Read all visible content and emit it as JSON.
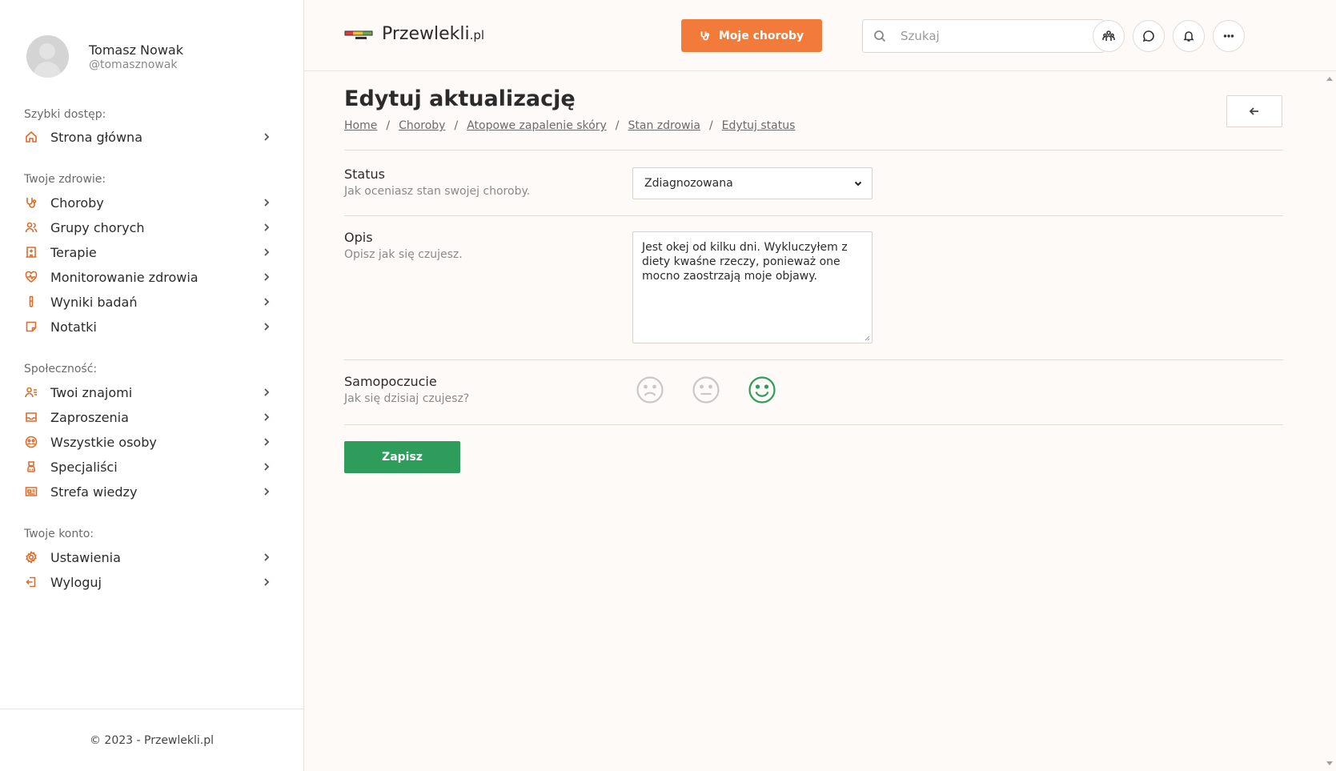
{
  "user": {
    "name": "Tomasz Nowak",
    "handle": "@tomasznowak"
  },
  "sidebar": {
    "sections": [
      {
        "title": "Szybki dostęp:",
        "items": [
          {
            "label": "Strona główna",
            "icon": "home-icon"
          }
        ]
      },
      {
        "title": "Twoje zdrowie:",
        "items": [
          {
            "label": "Choroby",
            "icon": "stethoscope-icon"
          },
          {
            "label": "Grupy chorych",
            "icon": "users-icon"
          },
          {
            "label": "Terapie",
            "icon": "hospital-icon"
          },
          {
            "label": "Monitorowanie zdrowia",
            "icon": "heart-pulse-icon"
          },
          {
            "label": "Wyniki badań",
            "icon": "test-tube-icon"
          },
          {
            "label": "Notatki",
            "icon": "note-icon"
          }
        ]
      },
      {
        "title": "Społeczność:",
        "items": [
          {
            "label": "Twoi znajomi",
            "icon": "user-list-icon"
          },
          {
            "label": "Zaproszenia",
            "icon": "inbox-icon"
          },
          {
            "label": "Wszystkie osoby",
            "icon": "globe-people-icon"
          },
          {
            "label": "Specjaliści",
            "icon": "doctor-icon"
          },
          {
            "label": "Strefa wiedzy",
            "icon": "newspaper-icon"
          }
        ]
      },
      {
        "title": "Twoje konto:",
        "items": [
          {
            "label": "Ustawienia",
            "icon": "gear-icon"
          },
          {
            "label": "Wyloguj",
            "icon": "logout-icon"
          }
        ]
      }
    ],
    "footer": "© 2023 - Przewlekli.pl"
  },
  "header": {
    "logo_main": "Przewlekli",
    "logo_suffix": ".pl",
    "diseases_button": "Moje choroby",
    "search_placeholder": "Szukaj",
    "icons": [
      "friends-icon",
      "chat-icon",
      "bell-icon",
      "more-icon"
    ]
  },
  "page": {
    "title": "Edytuj aktualizację",
    "breadcrumb": [
      "Home",
      "Choroby",
      "Atopowe zapalenie skóry",
      "Stan zdrowia",
      "Edytuj status"
    ],
    "form": {
      "status": {
        "label": "Status",
        "hint": "Jak oceniasz stan swojej choroby.",
        "value": "Zdiagnozowana"
      },
      "description": {
        "label": "Opis",
        "hint": "Opisz jak się czujesz.",
        "value": "Jest okej od kilku dni. Wykluczyłem z diety kwaśne rzeczy, ponieważ one mocno zaostrzają moje objawy."
      },
      "mood": {
        "label": "Samopoczucie",
        "hint": "Jak się dzisiaj czujesz?",
        "options": [
          "sad",
          "neutral",
          "happy"
        ],
        "selected": "happy"
      },
      "save_button": "Zapisz"
    }
  },
  "colors": {
    "accent": "#f27b3c",
    "icon": "#e06a2a",
    "save": "#2e9d5b",
    "mood_selected": "#2e9d5b",
    "mood_default": "#c8c8c8"
  }
}
